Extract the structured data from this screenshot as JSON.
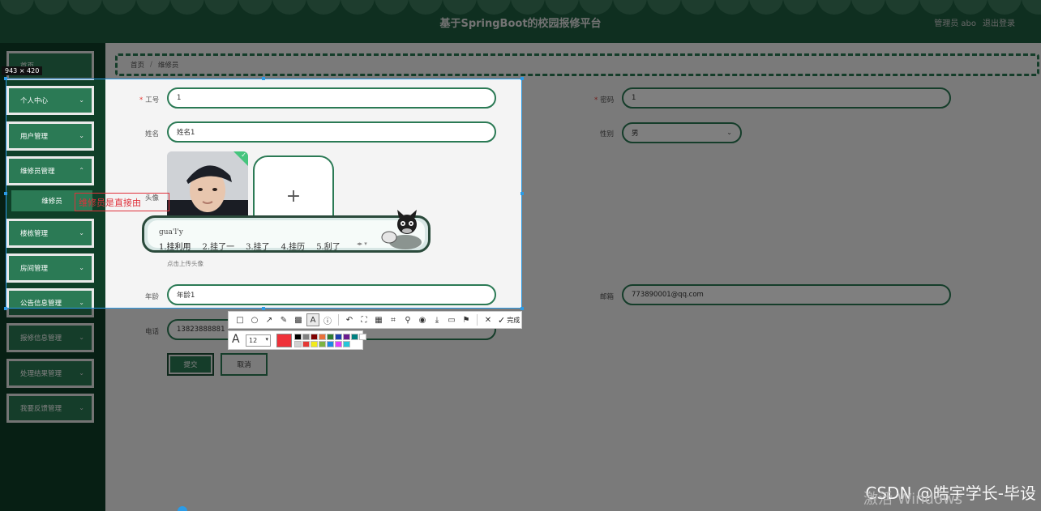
{
  "header": {
    "title": "基于SpringBoot的校园报修平台",
    "user": "管理员 abo",
    "logout": "退出登录"
  },
  "sidebar": {
    "items": [
      {
        "label": "首页"
      },
      {
        "label": "个人中心"
      },
      {
        "label": "用户管理"
      },
      {
        "label": "维修员管理"
      },
      {
        "label": "维修员"
      },
      {
        "label": "楼栋管理"
      },
      {
        "label": "房间管理"
      },
      {
        "label": "公告信息管理"
      },
      {
        "label": "报修信息管理"
      },
      {
        "label": "处理结果管理"
      },
      {
        "label": "我要反馈管理"
      }
    ]
  },
  "breadcrumb": {
    "home": "首页",
    "separator": "/",
    "current": "维修员"
  },
  "form": {
    "id_label": "工号",
    "id_value": "1",
    "password_label": "密码",
    "password_value": "1",
    "name_label": "姓名",
    "name_value": "姓名1",
    "gender_label": "性别",
    "gender_value": "男",
    "avatar_label": "头像",
    "avatar_hint": "点击上传头像",
    "upload_plus": "+",
    "age_label": "年龄",
    "age_value": "年龄1",
    "email_label": "邮箱",
    "email_value": "773890001@qq.com",
    "phone_label": "电话",
    "phone_value": "13823888881",
    "submit": "提交",
    "cancel": "取消"
  },
  "capture": {
    "size": "943 × 420",
    "annotation_text": "维修员是直接由"
  },
  "ime": {
    "pinyin": "gua'l'y",
    "candidates": [
      "1.挂利用",
      "2.挂了一",
      "3.挂了",
      "4.挂历",
      "5.刮了"
    ]
  },
  "toolbar": {
    "done": "完成",
    "font_size": "12",
    "current_color": "#ef3139",
    "palette": [
      "#000000",
      "#808080",
      "#800000",
      "#e8703a",
      "#2e7d32",
      "#1e40af",
      "#6b1b8f",
      "#008080",
      "#ffffff",
      "#d0d0d0",
      "#e53935",
      "#f2ea1c",
      "#7cb342",
      "#1e88e5",
      "#e040fb",
      "#26c6da"
    ]
  },
  "watermark": "CSDN @皓宇学长-毕设",
  "os_notice": "激活 Windows"
}
